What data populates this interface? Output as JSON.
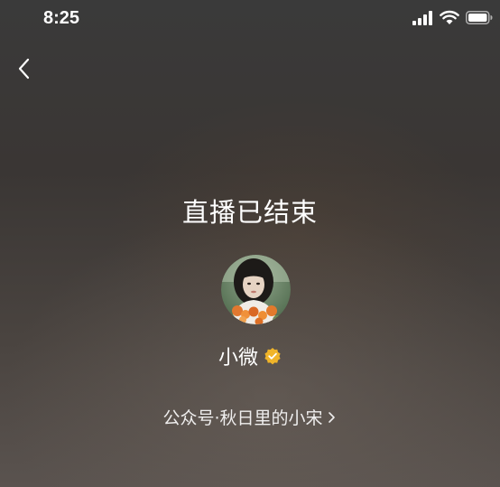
{
  "status_bar": {
    "time": "8:25",
    "icons": [
      "signal-icon",
      "wifi-icon",
      "battery-icon"
    ]
  },
  "nav": {
    "back_icon": "chevron-left-icon"
  },
  "main": {
    "title": "直播已结束",
    "account_name": "小微",
    "verified_icon": "verified-badge-icon",
    "verified_color": "#f0b429",
    "account_link": "公众号·秋日里的小宋"
  }
}
